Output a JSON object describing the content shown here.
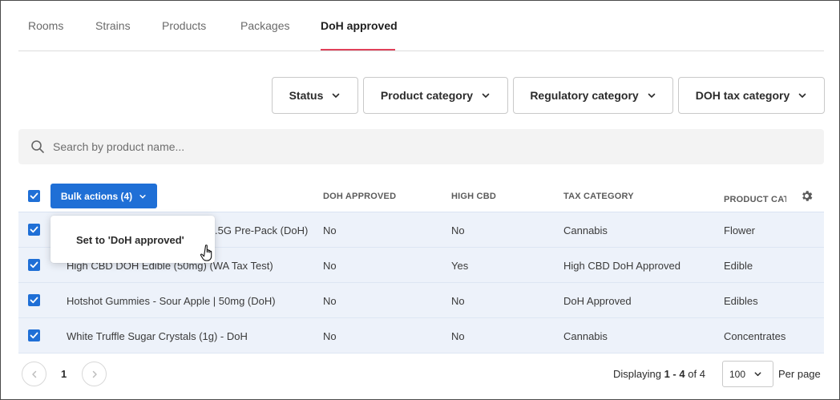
{
  "tabs": [
    {
      "label": "Rooms"
    },
    {
      "label": "Strains"
    },
    {
      "label": "Products"
    },
    {
      "label": "Packages"
    },
    {
      "label": "DoH approved",
      "active": true
    }
  ],
  "filters": {
    "status": "Status",
    "product_category": "Product category",
    "regulatory_category": "Regulatory category",
    "doh_tax_category": "DOH tax category"
  },
  "search": {
    "placeholder": "Search by product name...",
    "value": ""
  },
  "table": {
    "bulk_actions_label": "Bulk actions (4)",
    "columns": [
      "DOH APPROVED",
      "HIGH CBD",
      "TAX CATEGORY",
      "PRODUCT CATEGORY"
    ],
    "rows": [
      {
        "name": ".5G Pre-Pack (DoH)",
        "doh_approved": "No",
        "high_cbd": "No",
        "tax_category": "Cannabis",
        "product_category": "Flower",
        "checked": true
      },
      {
        "name": "High CBD DOH Edible (50mg) (WA Tax Test)",
        "doh_approved": "No",
        "high_cbd": "Yes",
        "tax_category": "High CBD DoH Approved",
        "product_category": "Edible",
        "checked": true
      },
      {
        "name": "Hotshot Gummies - Sour Apple | 50mg (DoH)",
        "doh_approved": "No",
        "high_cbd": "No",
        "tax_category": "DoH Approved",
        "product_category": "Edibles",
        "checked": true
      },
      {
        "name": "White Truffle Sugar Crystals (1g) - DoH",
        "doh_approved": "No",
        "high_cbd": "No",
        "tax_category": "Cannabis",
        "product_category": "Concentrates",
        "checked": true
      }
    ]
  },
  "menu": {
    "item": "Set to 'DoH approved'"
  },
  "footer": {
    "page": "1",
    "displaying_prefix": "Displaying ",
    "displaying_range": "1 - 4",
    "displaying_mid": " of ",
    "displaying_total": "4",
    "per_page_value": "100",
    "per_page_label": "Per page"
  },
  "colors": {
    "accent": "#1f6fd6",
    "tab_underline": "#e0415a",
    "row_bg": "#edf2fa"
  }
}
